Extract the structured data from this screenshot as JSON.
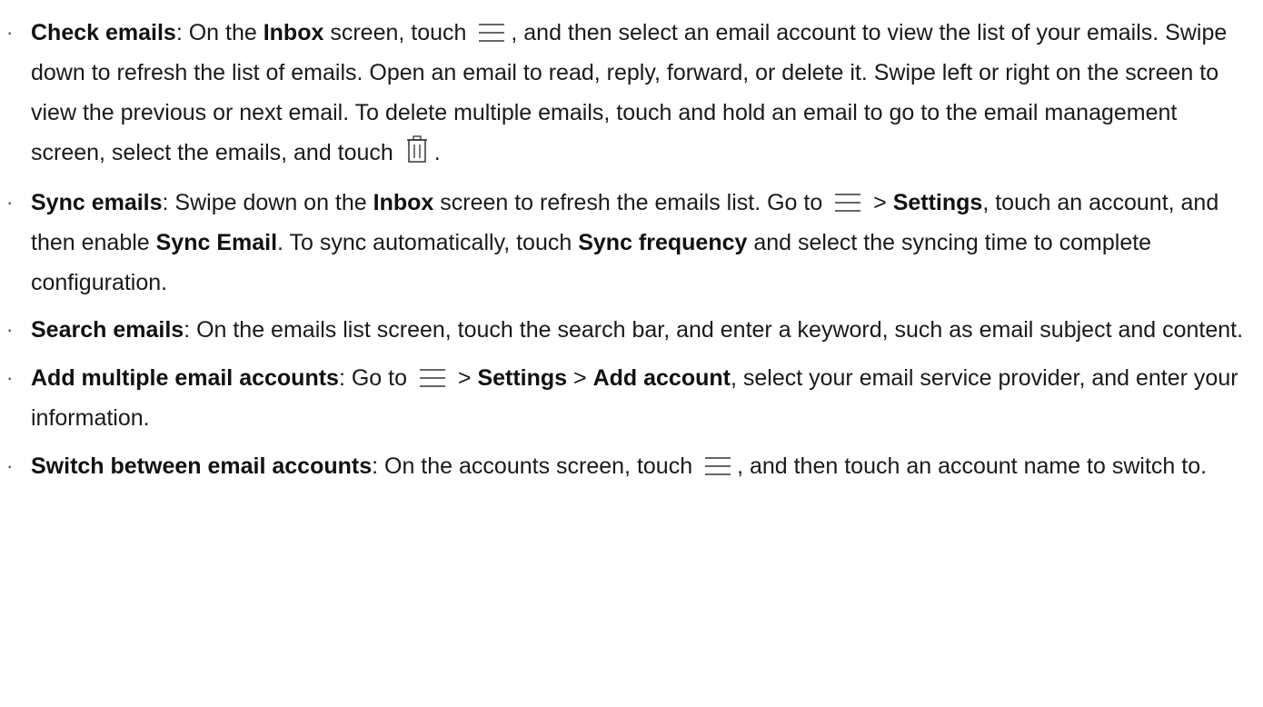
{
  "items": [
    {
      "title": "Check emails",
      "t1": ": On the ",
      "b1": "Inbox",
      "t2": " screen, touch ",
      "icon1": "menu-icon",
      "t3": ", and then select an email account to view the list of your emails. Swipe down to refresh the list of emails. Open an email to read, reply, forward, or delete it. Swipe left or right on the screen to view the previous or next email. To delete multiple emails, touch and hold an email to go to the email management screen, select the emails, and touch ",
      "icon2": "trash-icon",
      "t4": "."
    },
    {
      "title": "Sync emails",
      "t1": ": Swipe down on the ",
      "b1": "Inbox",
      "t2": " screen to refresh the emails list. Go to ",
      "icon1": "menu-icon",
      "t3": " > ",
      "b2": "Settings",
      "t4": ", touch an account, and then enable ",
      "b3": "Sync Email",
      "t5": ". To sync automatically, touch ",
      "b4": "Sync frequency",
      "t6": " and select the syncing time to complete configuration."
    },
    {
      "title": "Search emails",
      "t1": ": On the emails list screen, touch the search bar, and enter a keyword, such as email subject and content."
    },
    {
      "title": "Add multiple email accounts",
      "t1": ": Go to ",
      "icon1": "menu-icon",
      "t2": " > ",
      "b1": "Settings",
      "t3": " > ",
      "b2": "Add account",
      "t4": ", select your email service provider, and enter your information."
    },
    {
      "title": "Switch between email accounts",
      "t1": ": On the accounts screen, touch ",
      "icon1": "menu-icon",
      "t2": ", and then touch an account name to switch to."
    }
  ],
  "bullet": "·"
}
